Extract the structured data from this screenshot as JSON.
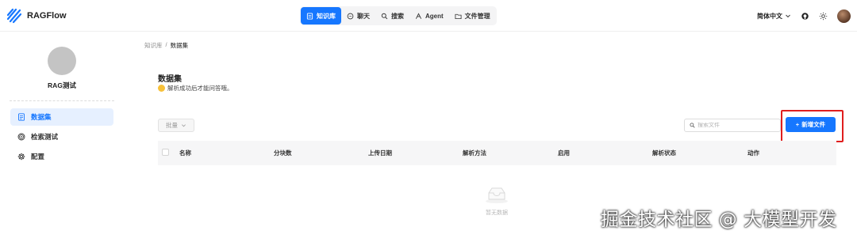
{
  "brand": {
    "name": "RAGFlow",
    "icon": "ragflow-logo-icon"
  },
  "nav": {
    "items": [
      {
        "label": "知识库",
        "icon": "database-icon",
        "active": true
      },
      {
        "label": "聊天",
        "icon": "chat-icon",
        "active": false
      },
      {
        "label": "搜索",
        "icon": "search-icon",
        "active": false
      },
      {
        "label": "Agent",
        "icon": "agent-icon",
        "active": false
      },
      {
        "label": "文件管理",
        "icon": "folder-icon",
        "active": false
      }
    ]
  },
  "top_right": {
    "language": "简体中文",
    "github_icon": "github-icon",
    "theme_icon": "sun-icon"
  },
  "sidebar": {
    "kb_name": "RAG测试",
    "items": [
      {
        "label": "数据集",
        "icon": "file-text-icon",
        "active": true
      },
      {
        "label": "检索测试",
        "icon": "target-icon",
        "active": false
      },
      {
        "label": "配置",
        "icon": "settings-icon",
        "active": false
      }
    ]
  },
  "breadcrumb": {
    "root": "知识库",
    "separator": "/",
    "current": "数据集"
  },
  "page": {
    "title": "数据集",
    "description": "解析成功后才能问答哦。"
  },
  "toolbar": {
    "batch_label": "批量",
    "search_placeholder": "搜索文件",
    "add_file_label": "新增文件"
  },
  "table": {
    "columns": [
      "名称",
      "分块数",
      "上传日期",
      "解析方法",
      "启用",
      "解析状态",
      "动作"
    ],
    "empty_text": "暂无数据"
  },
  "watermark": "掘金技术社区 @ 大模型开发",
  "colors": {
    "accent": "#1677ff",
    "highlight": "#e01e1e"
  }
}
